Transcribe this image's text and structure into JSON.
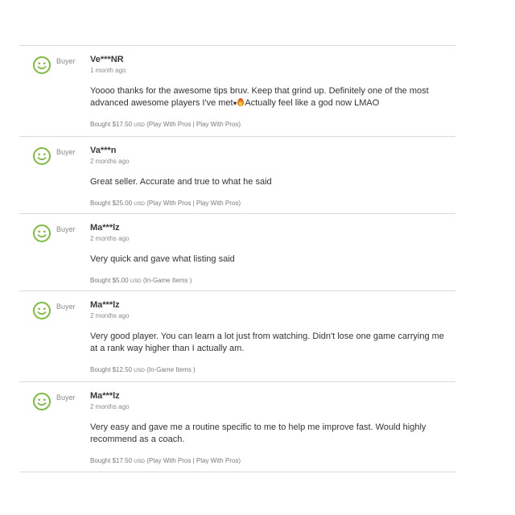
{
  "colors": {
    "accent": "#7cbb3f",
    "divider": "#d9d9d9",
    "muted": "#8a8a8a"
  },
  "reviews": [
    {
      "role": "Buyer",
      "name": "Ve***NR",
      "time": "1 month ago",
      "text_before": "Yoooo thanks for the awesome tips bruv. Keep that grind up. Definitely one of the most advanced awesome players I've met",
      "text_after": "Actually feel like a god now LMAO",
      "bought_prefix": "Bought $17.50",
      "currency": "USD",
      "category": "(Play With Pros | Play With Pros)"
    },
    {
      "role": "Buyer",
      "name": "Va***n",
      "time": "2 months ago",
      "text": "Great seller. Accurate and true to what he said",
      "bought_prefix": "Bought $25.00",
      "currency": "USD",
      "category": "(Play With Pros | Play With Pros)"
    },
    {
      "role": "Buyer",
      "name": "Ma***lz",
      "time": "2 months ago",
      "text": "Very quick and gave what listing said",
      "bought_prefix": "Bought $5.00",
      "currency": "USD",
      "category": "(In-Game Items )"
    },
    {
      "role": "Buyer",
      "name": "Ma***lz",
      "time": "2 months ago",
      "text": "Very good player. You can learn a lot just from watching. Didn't lose one game carrying me at a rank way higher than I actually am.",
      "bought_prefix": "Bought $12.50",
      "currency": "USD",
      "category": "(In-Game Items )"
    },
    {
      "role": "Buyer",
      "name": "Ma***lz",
      "time": "2 months ago",
      "text": "Very easy and gave me a routine specific to me to help me improve fast. Would highly recommend as a coach.",
      "bought_prefix": "Bought $17.50",
      "currency": "USD",
      "category": "(Play With Pros | Play With Pros)"
    }
  ]
}
